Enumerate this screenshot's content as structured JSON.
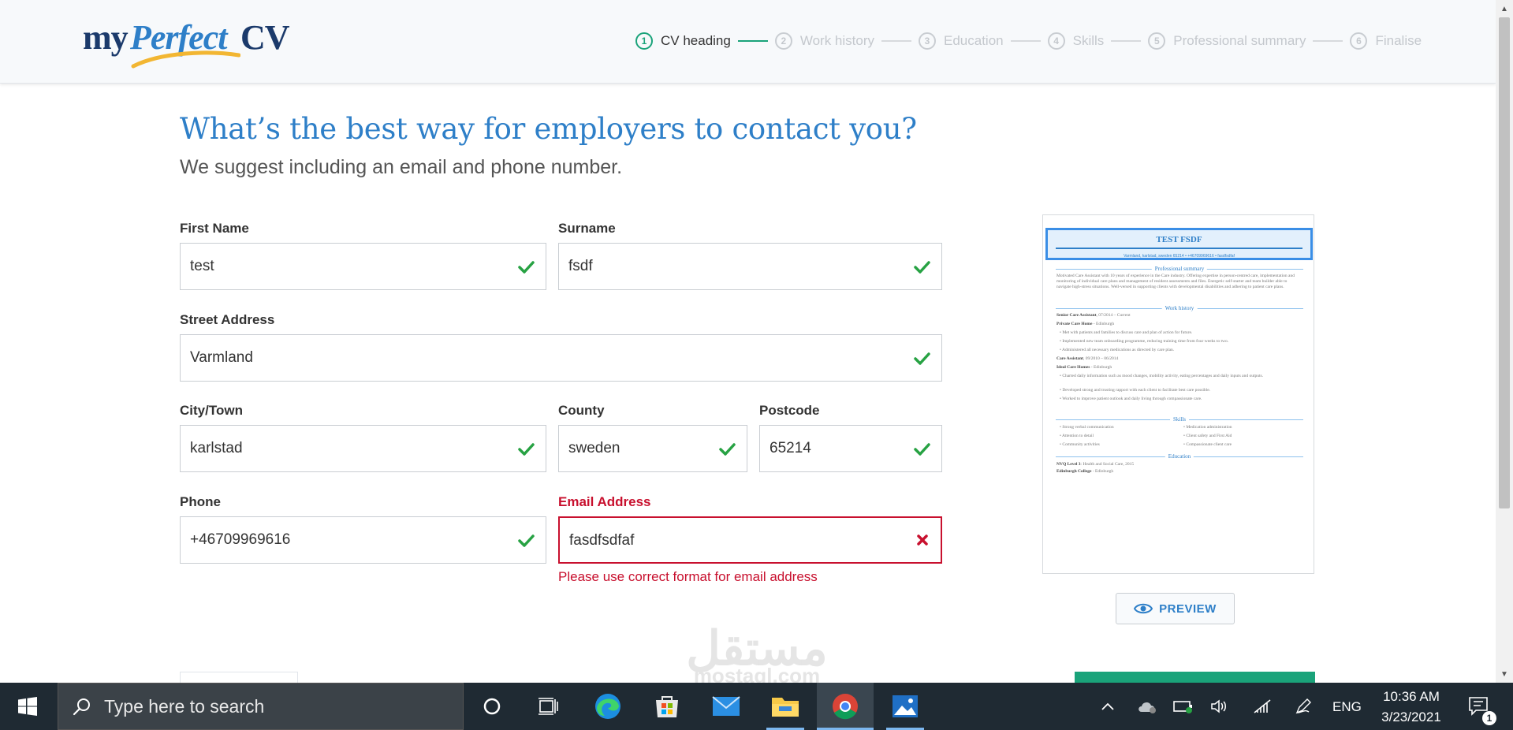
{
  "brand": {
    "logo_my": "my",
    "logo_perfect": "Perfect",
    "logo_cv": "CV"
  },
  "stepper": [
    {
      "num": "1",
      "label": "CV heading",
      "active": true
    },
    {
      "num": "2",
      "label": "Work history",
      "active": false
    },
    {
      "num": "3",
      "label": "Education",
      "active": false
    },
    {
      "num": "4",
      "label": "Skills",
      "active": false
    },
    {
      "num": "5",
      "label": "Professional summary",
      "active": false
    },
    {
      "num": "6",
      "label": "Finalise",
      "active": false
    }
  ],
  "colors": {
    "accent_blue": "#2e7fc8",
    "success_green": "#1aa37a",
    "check_green": "#27a243",
    "error_red": "#c8102e"
  },
  "heading": "What’s the best way for employers to contact you?",
  "subheading": "We suggest including an email and phone number.",
  "form": {
    "first_name": {
      "label": "First Name",
      "value": "test",
      "status": "valid"
    },
    "surname": {
      "label": "Surname",
      "value": "fsdf",
      "status": "valid"
    },
    "street": {
      "label": "Street Address",
      "value": "Varmland",
      "status": "valid"
    },
    "city": {
      "label": "City/Town",
      "value": "karlstad",
      "status": "valid"
    },
    "county": {
      "label": "County",
      "value": "sweden",
      "status": "valid"
    },
    "postcode": {
      "label": "Postcode",
      "value": "65214",
      "status": "valid"
    },
    "phone": {
      "label": "Phone",
      "value": "+46709969616",
      "status": "valid"
    },
    "email": {
      "label": "Email Address",
      "value": "fasdfsdfaf",
      "status": "invalid",
      "error": "Please use correct format for email address"
    }
  },
  "cv_preview": {
    "name": "TEST FSDF",
    "contact": "Varmland, karlstad, sweden 65214   •   +46709969616   •   fasdfsdfaf",
    "sections": {
      "summary": "Professional summary",
      "work": "Work history",
      "skills": "Skills",
      "education": "Education"
    },
    "summary_text": "Motivated Care Assistant with 10 years of experience in the Care industry. Offering expertise in person-centred care, implementation and monitoring of individual care plans and management of resident assessments and files. Energetic self-starter and team builder able to navigate high-stress situations. Well-versed in supporting clients with developmental disabilities and adhering to patient care plans.",
    "job1_title": "Senior Care Assistant",
    "job1_dates": ", 07/2014 – Current",
    "job1_company": "Private Care Home",
    "job1_location": " - Edinburgh",
    "job1_bullets": [
      "Met with patients and families to discuss care and plan of action for future.",
      "Implemented new team onboarding programme, reducing training time from four weeks to two.",
      "Administered all necessary medications as directed by care plan."
    ],
    "job2_title": "Care Assistant",
    "job2_dates": ", 09/2010 – 06/2014",
    "job2_company": "Ideal Care Homes",
    "job2_location": " - Edinburgh",
    "job2_bullets": [
      "Charted daily information such as mood changes, mobility activity, eating percentages and daily inputs and outputs.",
      "Developed strong and trusting rapport with each client to facilitate best care possible.",
      "Worked to improve patient outlook and daily living through compassionate care."
    ],
    "skills_left": [
      "Strong verbal communication",
      "Attention to detail",
      "Community activities"
    ],
    "skills_right": [
      "Medication administration",
      "Client safety and First Aid",
      "Compassionate client care"
    ],
    "edu_line1_bold": "NVQ Level 3",
    "edu_line1": ": Health and Social Care, 2015",
    "edu_line2_bold": "Edinburgh College",
    "edu_line2": " - Edinburgh"
  },
  "preview_button": "PREVIEW",
  "watermark": {
    "arabic": "مستقل",
    "latin": "mostaql.com"
  },
  "taskbar": {
    "search_placeholder": "Type here to search",
    "language": "ENG",
    "time": "10:36 AM",
    "date": "3/23/2021",
    "notification_count": "1"
  }
}
